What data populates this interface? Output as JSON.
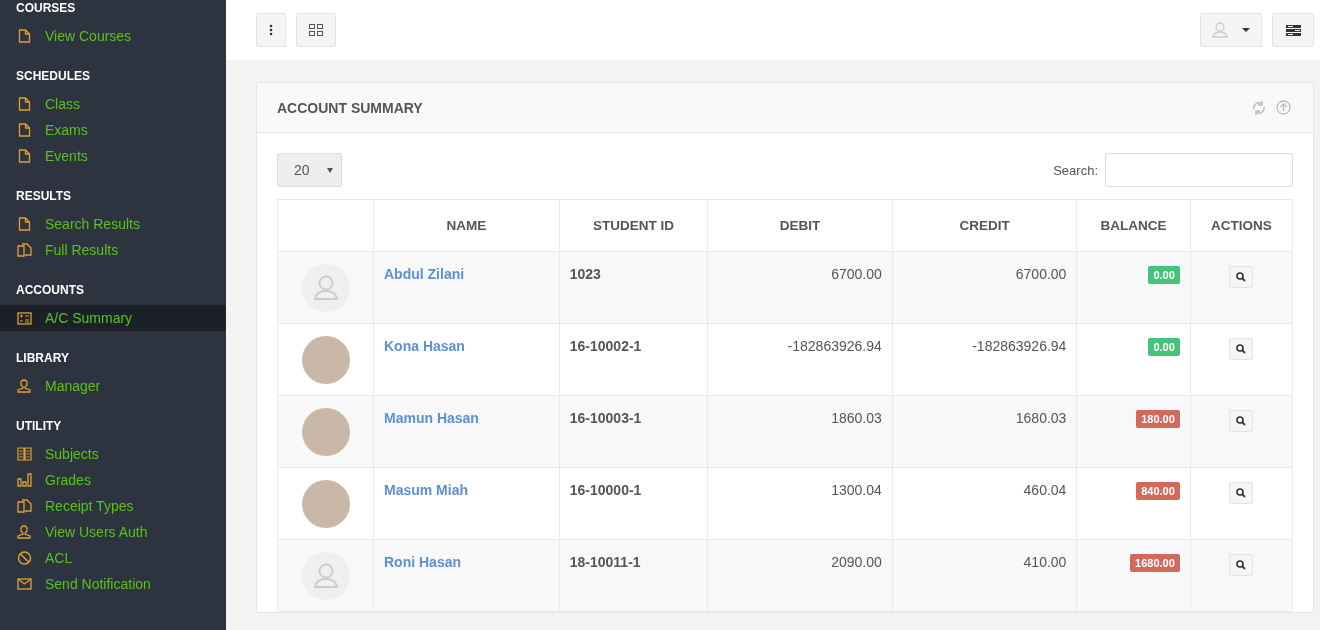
{
  "sidebar": {
    "sections": [
      {
        "title": "COURSES",
        "items": [
          {
            "label": "View Courses",
            "kind": "file",
            "selected": false
          }
        ]
      },
      {
        "title": "SCHEDULES",
        "items": [
          {
            "label": "Class",
            "kind": "file",
            "selected": false
          },
          {
            "label": "Exams",
            "kind": "file",
            "selected": false
          },
          {
            "label": "Events",
            "kind": "file",
            "selected": false
          }
        ]
      },
      {
        "title": "RESULTS",
        "items": [
          {
            "label": "Search Results",
            "kind": "file",
            "selected": false
          },
          {
            "label": "Full Results",
            "kind": "files",
            "selected": false
          }
        ]
      },
      {
        "title": "ACCOUNTS",
        "items": [
          {
            "label": "A/C Summary",
            "kind": "calc",
            "selected": true
          }
        ]
      },
      {
        "title": "LIBRARY",
        "items": [
          {
            "label": "Manager",
            "kind": "user",
            "selected": false
          }
        ]
      },
      {
        "title": "UTILITY",
        "items": [
          {
            "label": "Subjects",
            "kind": "book",
            "selected": false
          },
          {
            "label": "Grades",
            "kind": "chart",
            "selected": false
          },
          {
            "label": "Receipt Types",
            "kind": "files",
            "selected": false
          },
          {
            "label": "View Users Auth",
            "kind": "user",
            "selected": false
          },
          {
            "label": "ACL",
            "kind": "ban",
            "selected": false
          },
          {
            "label": "Send Notification",
            "kind": "mail",
            "selected": false
          }
        ]
      }
    ]
  },
  "panel": {
    "title": "ACCOUNT SUMMARY",
    "page_size": "20",
    "search_label": "Search:",
    "table": {
      "columns": [
        "NAME",
        "STUDENT ID",
        "DEBIT",
        "CREDIT",
        "BALANCE",
        "ACTIONS"
      ],
      "rows": [
        {
          "kind": "placeholder",
          "name": "Abdul Zilani",
          "student_id": "1023",
          "debit": "6700.00",
          "credit": "6700.00",
          "balance": "0.00",
          "color": "#46c37b"
        },
        {
          "kind": "photo",
          "name": "Kona Hasan",
          "student_id": "16-10002-1",
          "debit": "-182863926.94",
          "credit": "-182863926.94",
          "balance": "0.00",
          "color": "#46c37b"
        },
        {
          "kind": "photo",
          "name": "Mamun Hasan",
          "student_id": "16-10003-1",
          "debit": "1860.03",
          "credit": "1680.03",
          "balance": "180.00",
          "color": "#d26a5c"
        },
        {
          "kind": "photo",
          "name": "Masum Miah",
          "student_id": "16-10000-1",
          "debit": "1300.04",
          "credit": "460.04",
          "balance": "840.00",
          "color": "#d26a5c"
        },
        {
          "kind": "placeholder",
          "name": "Roni Hasan",
          "student_id": "18-10011-1",
          "debit": "2090.00",
          "credit": "410.00",
          "balance": "1680.00",
          "color": "#d26a5c"
        }
      ]
    }
  }
}
